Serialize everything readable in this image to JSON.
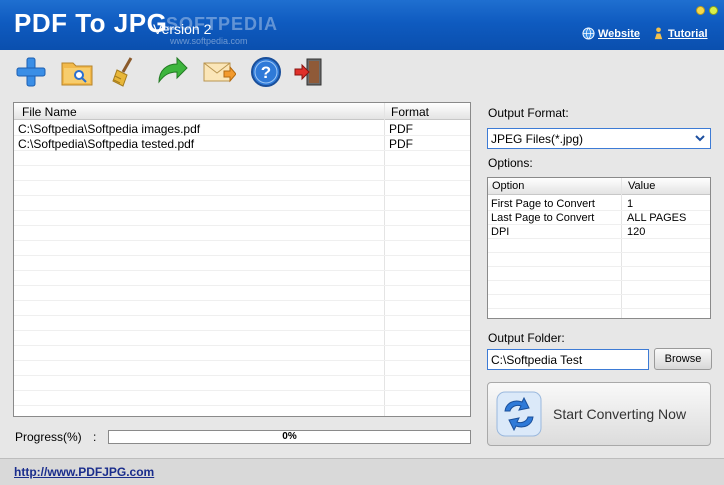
{
  "window": {
    "title": "PDF To JPG",
    "version": "Version 2",
    "watermark": "SOFTPEDIA",
    "watermark_url": "www.softpedia.com",
    "links": {
      "website": "Website",
      "tutorial": "Tutorial"
    }
  },
  "toolbar": {
    "buttons": [
      {
        "name": "add-files",
        "icon": "plus-icon"
      },
      {
        "name": "open-folder",
        "icon": "folder-search-icon"
      },
      {
        "name": "clear-list",
        "icon": "broom-icon"
      },
      {
        "name": "refresh",
        "icon": "green-arrow-icon"
      },
      {
        "name": "email",
        "icon": "envelope-icon"
      },
      {
        "name": "help",
        "icon": "help-icon"
      },
      {
        "name": "exit",
        "icon": "exit-door-icon"
      }
    ]
  },
  "file_list": {
    "columns": [
      "File Name",
      "Format"
    ],
    "rows": [
      {
        "name": "C:\\Softpedia\\Softpedia images.pdf",
        "format": "PDF"
      },
      {
        "name": "C:\\Softpedia\\Softpedia tested.pdf",
        "format": "PDF"
      }
    ]
  },
  "output_format": {
    "label": "Output Format:",
    "value": "JPEG Files(*.jpg)"
  },
  "options": {
    "label": "Options:",
    "columns": [
      "Option",
      "Value"
    ],
    "rows": [
      {
        "option": "First Page to Convert",
        "value": "1"
      },
      {
        "option": "Last Page to Convert",
        "value": "ALL PAGES"
      },
      {
        "option": "DPI",
        "value": "120"
      }
    ]
  },
  "output_folder": {
    "label": "Output Folder:",
    "value": "C:\\Softpedia Test",
    "browse_label": "Browse"
  },
  "convert": {
    "label": "Start Converting Now"
  },
  "progress": {
    "label": "Progress(%)",
    "separator": ":",
    "text": "0%",
    "value": 0
  },
  "status": {
    "link": "http://www.PDFJPG.com"
  },
  "colors": {
    "titlebar": "#0f5bc0",
    "accent": "#3d7bd5",
    "progress": "#2f7ad8"
  }
}
